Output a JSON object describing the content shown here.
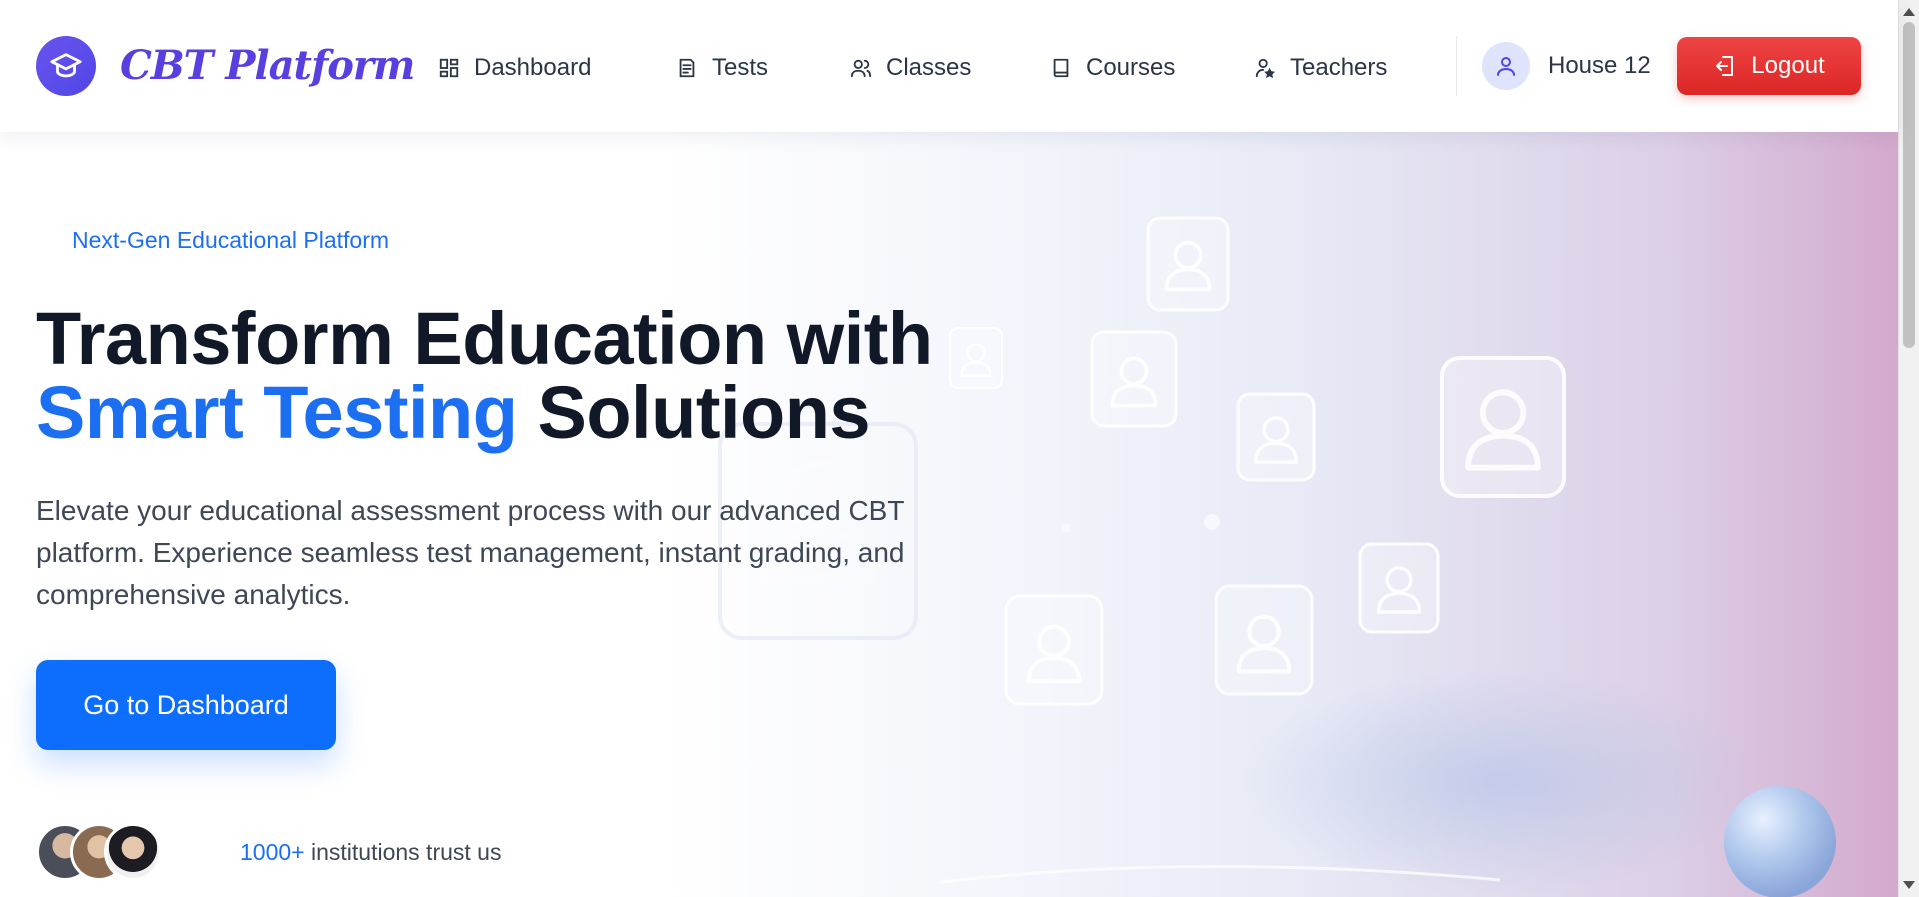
{
  "brand": {
    "name": "CBT Platform",
    "logo_icon": "graduation-cap-icon",
    "accent": "#5a3fe0"
  },
  "nav": [
    {
      "label": "Dashboard",
      "icon": "dashboard-grid-icon"
    },
    {
      "label": "Tests",
      "icon": "document-icon"
    },
    {
      "label": "Classes",
      "icon": "users-icon"
    },
    {
      "label": "Courses",
      "icon": "book-icon"
    },
    {
      "label": "Teachers",
      "icon": "user-star-icon"
    }
  ],
  "user": {
    "name": "House 12",
    "icon": "user-icon"
  },
  "logout": {
    "label": "Logout",
    "icon": "logout-icon",
    "color": "#dc2626"
  },
  "hero": {
    "tagline": "Next-Gen Educational Platform",
    "title_line1": "Transform Education with",
    "title_accent": "Smart Testing",
    "title_rest": " Solutions",
    "description": "Elevate your educational assessment process with our advanced CBT platform. Experience seamless test management, instant grading, and comprehensive analytics.",
    "cta": "Go to Dashboard",
    "trust_number": "1000+",
    "trust_text": " institutions trust us",
    "accent": "#0d6efd"
  }
}
